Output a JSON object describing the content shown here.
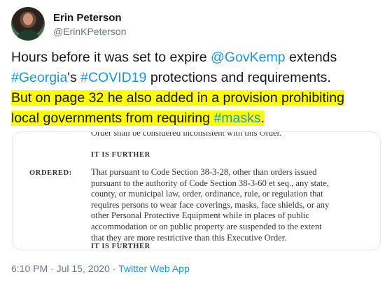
{
  "author": {
    "name": "Erin Peterson",
    "handle": "@ErinKPeterson"
  },
  "tweet": {
    "line1_a": "Hours before it was set to expire ",
    "line1_mention": "@GovKemp",
    "line1_b": " extends",
    "line2_tag1": "#Georgia",
    "line2_a": "'s ",
    "line2_tag2": "#COVID19",
    "line2_b": " protections and requirements.",
    "line3": "But on page 32 he also added in a provision prohibiting",
    "line4_a": "local governments from requiring ",
    "line4_tag": "#masks",
    "line4_b": "."
  },
  "document": {
    "top_text": "Order shall be considered inconsistent with this Order.",
    "further_1": "IT IS FURTHER",
    "ordered_label": "ORDERED:",
    "body_lines": [
      "That pursuant to Code Section 38-3-28, other than orders issued",
      "pursuant to the authority of Code Section 38-3-60 et seq., any state,",
      "county, or municipal law, order, ordinance, rule, or regulation that",
      "requires persons to wear face coverings, masks, face shields, or any",
      "other Personal Protective Equipment while in places of public",
      "accommodation or on public property are suspended to the extent",
      "that they are more restrictive than this Executive Order."
    ],
    "further_2": "IT IS FURTHER"
  },
  "meta": {
    "time_date": "6:10 PM · Jul 15, 2020 · ",
    "app": "Twitter Web App"
  },
  "colors": {
    "link": "#1b95e0",
    "highlight": "#ffff00",
    "secondary_text": "#657786"
  }
}
